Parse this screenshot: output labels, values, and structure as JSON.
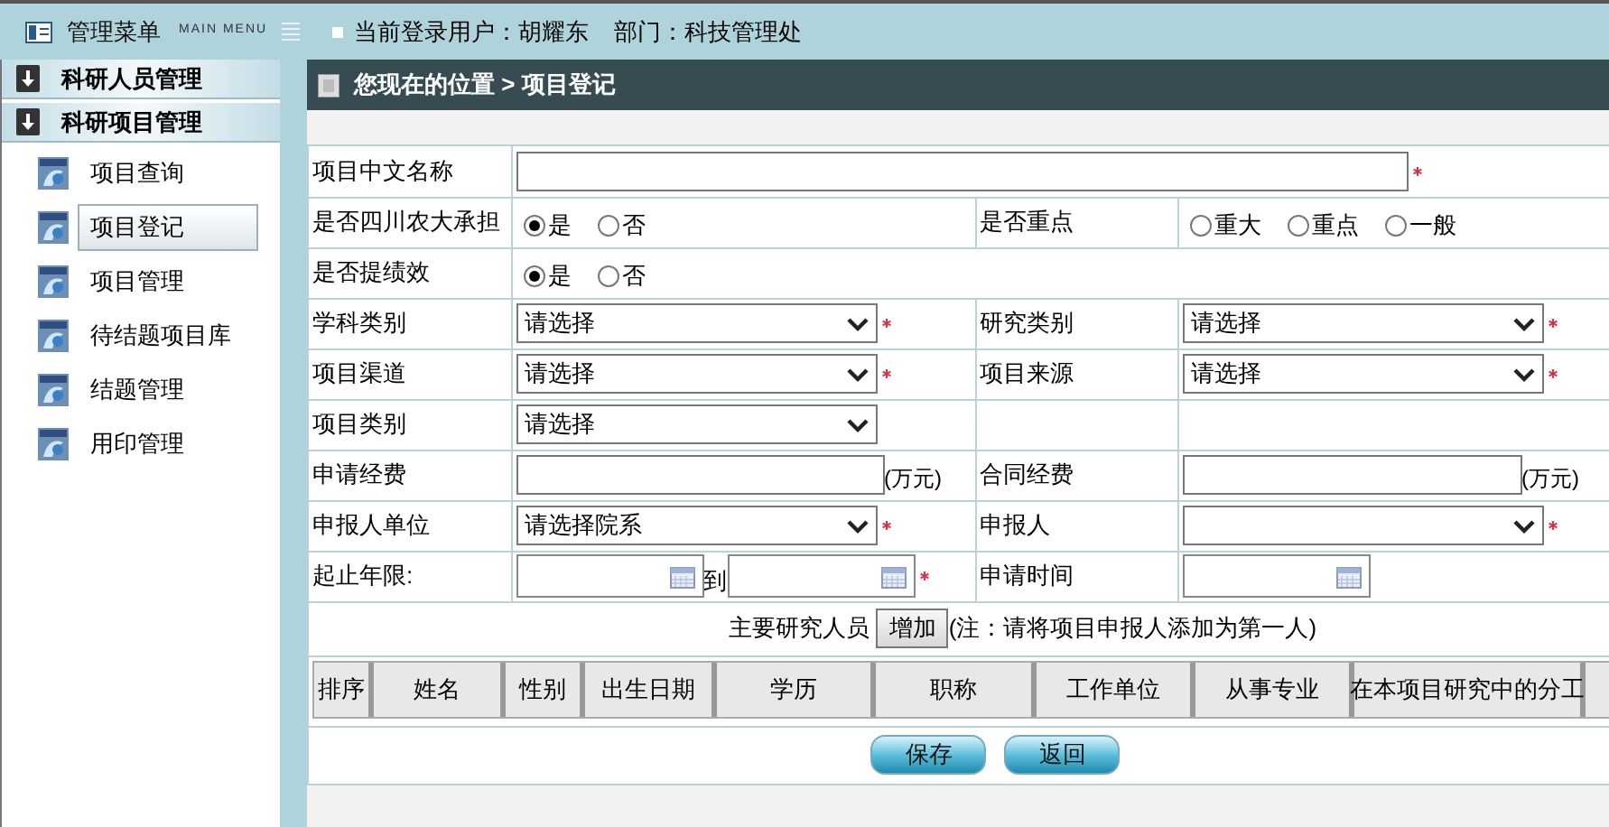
{
  "header": {
    "menu_title": "管理菜单",
    "menu_subtitle": "MAIN MENU",
    "user_info": "当前登录用户：胡耀东",
    "department": "部门：科技管理处"
  },
  "sidebar": {
    "sections": [
      {
        "label": "科研人员管理"
      },
      {
        "label": "科研项目管理"
      }
    ],
    "items": [
      {
        "label": "项目查询",
        "selected": false
      },
      {
        "label": "项目登记",
        "selected": true
      },
      {
        "label": "项目管理",
        "selected": false
      },
      {
        "label": "待结题项目库",
        "selected": false
      },
      {
        "label": "结题管理",
        "selected": false
      },
      {
        "label": "用印管理",
        "selected": false
      }
    ]
  },
  "breadcrumb": "您现在的位置 > 项目登记",
  "form": {
    "rows": [
      {
        "cells": [
          {
            "label": "项目中文名称",
            "field": {
              "kind": "text",
              "required": true
            }
          }
        ]
      },
      {
        "cells": [
          {
            "label": "是否四川农大承担",
            "field": {
              "kind": "radio",
              "options": [
                {
                  "label": "是",
                  "selected": true
                },
                {
                  "label": "否",
                  "selected": false
                }
              ]
            }
          },
          {
            "label": "是否重点",
            "field": {
              "kind": "radio",
              "options": [
                {
                  "label": "重大",
                  "selected": false
                },
                {
                  "label": "重点",
                  "selected": false
                },
                {
                  "label": "一般",
                  "selected": false
                }
              ]
            }
          }
        ]
      },
      {
        "cells": [
          {
            "label": "是否提绩效",
            "field": {
              "kind": "radio",
              "options": [
                {
                  "label": "是",
                  "selected": true
                },
                {
                  "label": "否",
                  "selected": false
                }
              ]
            }
          }
        ]
      },
      {
        "cells": [
          {
            "label": "学科类别",
            "field": {
              "kind": "select",
              "value": "请选择",
              "required": true
            }
          },
          {
            "label": "研究类别",
            "field": {
              "kind": "select",
              "value": "请选择",
              "required": true
            }
          }
        ]
      },
      {
        "cells": [
          {
            "label": "项目渠道",
            "field": {
              "kind": "select",
              "value": "请选择",
              "required": true
            }
          },
          {
            "label": "项目来源",
            "field": {
              "kind": "select",
              "value": "请选择",
              "required": true
            }
          }
        ]
      },
      {
        "cells": [
          {
            "label": "项目类别",
            "field": {
              "kind": "select",
              "value": "请选择",
              "required": false
            }
          },
          {
            "field": {
              "kind": "empty"
            }
          }
        ]
      },
      {
        "cells": [
          {
            "label": "申请经费",
            "field": {
              "kind": "text",
              "unit": "(万元)",
              "required": false
            }
          },
          {
            "label": "合同经费",
            "field": {
              "kind": "text",
              "unit": "(万元)",
              "required": false
            }
          }
        ]
      },
      {
        "cells": [
          {
            "label": "申报人单位",
            "field": {
              "kind": "select",
              "value": "请选择院系",
              "required": true
            }
          },
          {
            "label": "申报人",
            "field": {
              "kind": "select",
              "required": true
            }
          }
        ]
      },
      {
        "cells": [
          {
            "label": "起止年限:",
            "field": {
              "kind": "date_range",
              "separator": "到",
              "required": true
            }
          },
          {
            "label": "申请时间",
            "field": {
              "kind": "date",
              "required": false
            }
          }
        ]
      }
    ]
  },
  "researchers": {
    "label": "主要研究人员",
    "add_button": "增加",
    "note": "(注：请将项目申报人添加为第一人)",
    "columns": [
      "排序",
      "姓名",
      "性别",
      "出生日期",
      "学历",
      "职称",
      "工作单位",
      "从事专业",
      "在本项目研究中的分工"
    ]
  },
  "buttons": [
    "保存",
    "返回"
  ]
}
